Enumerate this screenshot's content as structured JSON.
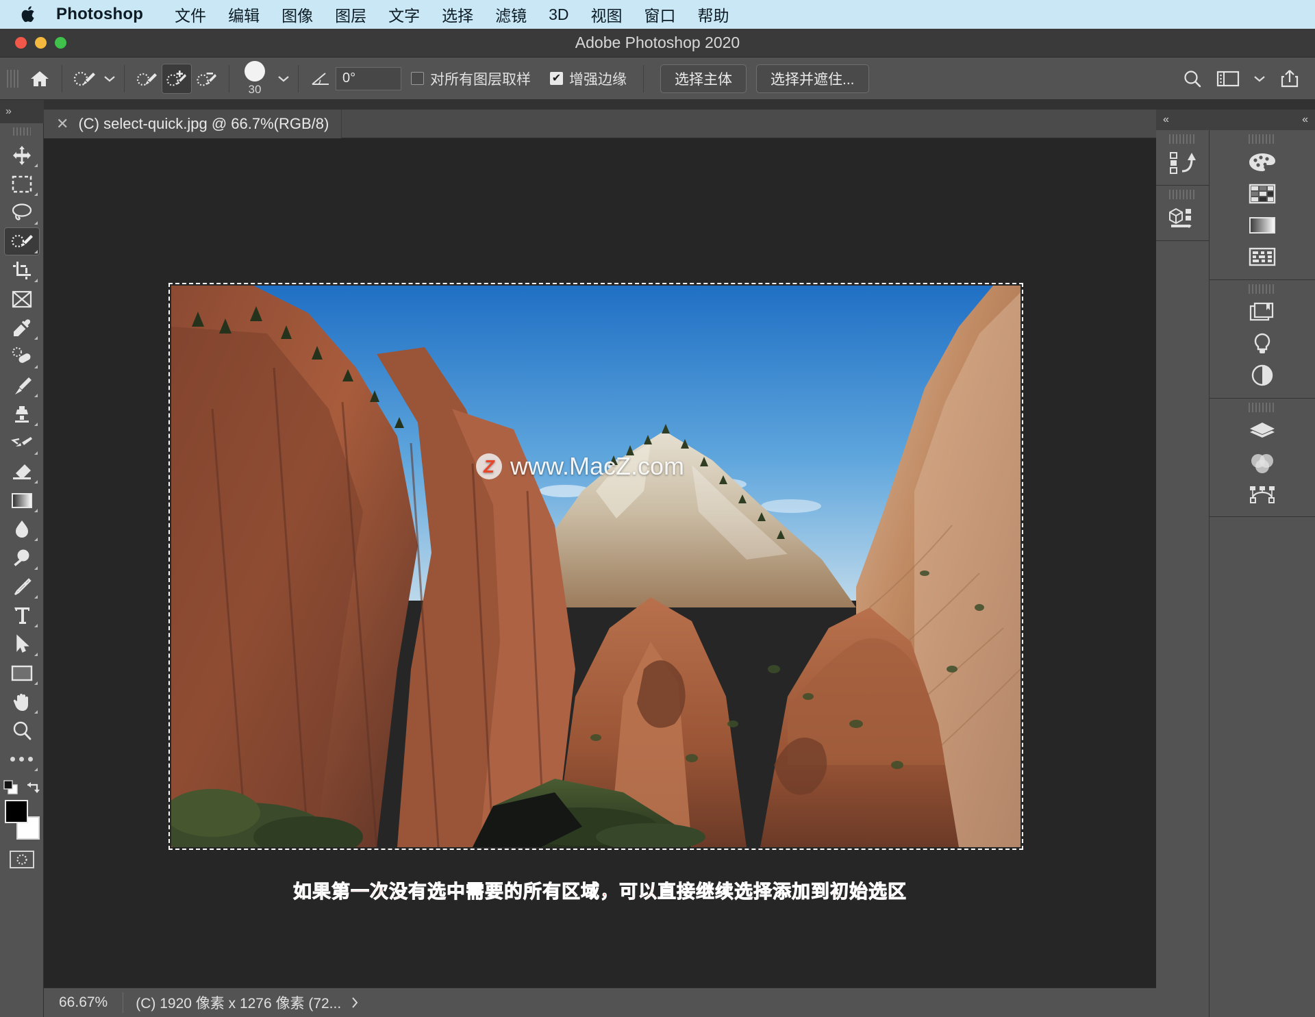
{
  "menubar": {
    "apple_icon": "apple-logo",
    "app_name": "Photoshop",
    "items": [
      "文件",
      "编辑",
      "图像",
      "图层",
      "文字",
      "选择",
      "滤镜",
      "3D",
      "视图",
      "窗口",
      "帮助"
    ]
  },
  "window": {
    "title": "Adobe Photoshop 2020",
    "traffic_lights": [
      "close",
      "minimize",
      "zoom"
    ]
  },
  "options_bar": {
    "home_icon": "home-icon",
    "tool_preset_icon": "quick-selection-tool-icon",
    "tool_preset_chevron": "chevron-down-icon",
    "mode_new_icon": "selection-new-icon",
    "mode_add_icon": "selection-add-icon",
    "mode_subtract_icon": "selection-subtract-icon",
    "brush_size": "30",
    "brush_chevron": "chevron-down-icon",
    "angle_icon": "angle-icon",
    "angle_value": "0°",
    "sample_all_layers_label": "对所有图层取样",
    "sample_all_layers_checked": false,
    "enhance_edge_label": "增强边缘",
    "enhance_edge_checked": true,
    "select_subject_label": "选择主体",
    "select_and_mask_label": "选择并遮住...",
    "search_icon": "search-icon",
    "workspace_icon": "workspace-switcher-icon",
    "workspace_chevron": "chevron-down-icon",
    "share_icon": "share-icon"
  },
  "toolbar": {
    "collapse_label": "»",
    "tools": [
      {
        "name": "move-tool",
        "icon": "move-icon",
        "selected": false,
        "has_flyout": true
      },
      {
        "name": "rectangular-marquee-tool",
        "icon": "marquee-rect-icon",
        "selected": false,
        "has_flyout": true
      },
      {
        "name": "lasso-tool",
        "icon": "lasso-icon",
        "selected": false,
        "has_flyout": true
      },
      {
        "name": "quick-selection-tool",
        "icon": "quick-selection-icon",
        "selected": true,
        "has_flyout": true
      },
      {
        "name": "crop-tool",
        "icon": "crop-icon",
        "selected": false,
        "has_flyout": true
      },
      {
        "name": "frame-tool",
        "icon": "frame-icon",
        "selected": false,
        "has_flyout": false
      },
      {
        "name": "eyedropper-tool",
        "icon": "eyedropper-icon",
        "selected": false,
        "has_flyout": true
      },
      {
        "name": "spot-healing-brush-tool",
        "icon": "healing-brush-icon",
        "selected": false,
        "has_flyout": true
      },
      {
        "name": "brush-tool",
        "icon": "brush-icon",
        "selected": false,
        "has_flyout": true
      },
      {
        "name": "clone-stamp-tool",
        "icon": "clone-stamp-icon",
        "selected": false,
        "has_flyout": true
      },
      {
        "name": "history-brush-tool",
        "icon": "history-brush-icon",
        "selected": false,
        "has_flyout": true
      },
      {
        "name": "eraser-tool",
        "icon": "eraser-icon",
        "selected": false,
        "has_flyout": true
      },
      {
        "name": "gradient-tool",
        "icon": "gradient-icon",
        "selected": false,
        "has_flyout": true
      },
      {
        "name": "blur-tool",
        "icon": "blur-drop-icon",
        "selected": false,
        "has_flyout": true
      },
      {
        "name": "dodge-tool",
        "icon": "dodge-icon",
        "selected": false,
        "has_flyout": true
      },
      {
        "name": "pen-tool",
        "icon": "pen-icon",
        "selected": false,
        "has_flyout": true
      },
      {
        "name": "type-tool",
        "icon": "type-t-icon",
        "selected": false,
        "has_flyout": true
      },
      {
        "name": "path-selection-tool",
        "icon": "path-arrow-icon",
        "selected": false,
        "has_flyout": true
      },
      {
        "name": "rectangle-tool",
        "icon": "rectangle-shape-icon",
        "selected": false,
        "has_flyout": true
      },
      {
        "name": "hand-tool",
        "icon": "hand-icon",
        "selected": false,
        "has_flyout": true
      },
      {
        "name": "zoom-tool",
        "icon": "magnifier-icon",
        "selected": false,
        "has_flyout": false
      },
      {
        "name": "edit-toolbar",
        "icon": "ellipsis-icon",
        "selected": false,
        "has_flyout": true
      }
    ],
    "default_colors_icon": "default-colors-icon",
    "swap_colors_icon": "swap-colors-icon",
    "foreground_color": "#000000",
    "background_color": "#ffffff",
    "quick_mask_icon": "quick-mask-icon"
  },
  "document": {
    "tab_title": "(C) select-quick.jpg @ 66.7%(RGB/8)",
    "close_icon": "close-icon"
  },
  "canvas": {
    "watermark_badge": "Z",
    "watermark_text": "www.MacZ.com",
    "caption": "如果第一次没有选中需要的所有区域，可以直接继续选择添加到初始选区",
    "caption_color": "#ef6a55",
    "selection_active": true,
    "image_alt": "Zion canyon red sandstone cliffs under blue sky"
  },
  "status_bar": {
    "zoom": "66.67%",
    "doc_info": "(C) 1920 像素 x 1276 像素 (72...",
    "expand_icon": "chevron-right-icon"
  },
  "right_panels": {
    "collapse_left_icon": "collapse-left-icon",
    "collapse_right_icon": "collapse-right-icon",
    "column_a": [
      {
        "name": "history-panel",
        "icon": "history-icon"
      },
      {
        "name": "3d-panel",
        "icon": "3d-cube-icon"
      }
    ],
    "column_b_groups": [
      [
        {
          "name": "color-panel",
          "icon": "color-palette-icon"
        },
        {
          "name": "swatches-panel",
          "icon": "swatches-grid-icon"
        },
        {
          "name": "gradients-panel",
          "icon": "gradient-swatch-icon"
        },
        {
          "name": "patterns-panel",
          "icon": "patterns-icon"
        }
      ],
      [
        {
          "name": "libraries-panel",
          "icon": "libraries-icon"
        },
        {
          "name": "adjustments-panel",
          "icon": "lightbulb-icon"
        },
        {
          "name": "styles-panel",
          "icon": "half-circle-icon"
        }
      ],
      [
        {
          "name": "layers-panel",
          "icon": "layers-icon"
        },
        {
          "name": "channels-panel",
          "icon": "channels-venn-icon"
        },
        {
          "name": "paths-panel",
          "icon": "paths-bezier-icon"
        }
      ]
    ]
  },
  "colors": {
    "menubar_bg": "#c9e7f5",
    "panel_bg": "#535353",
    "canvas_bg": "#262626",
    "accent_red": "#ef6a55"
  }
}
